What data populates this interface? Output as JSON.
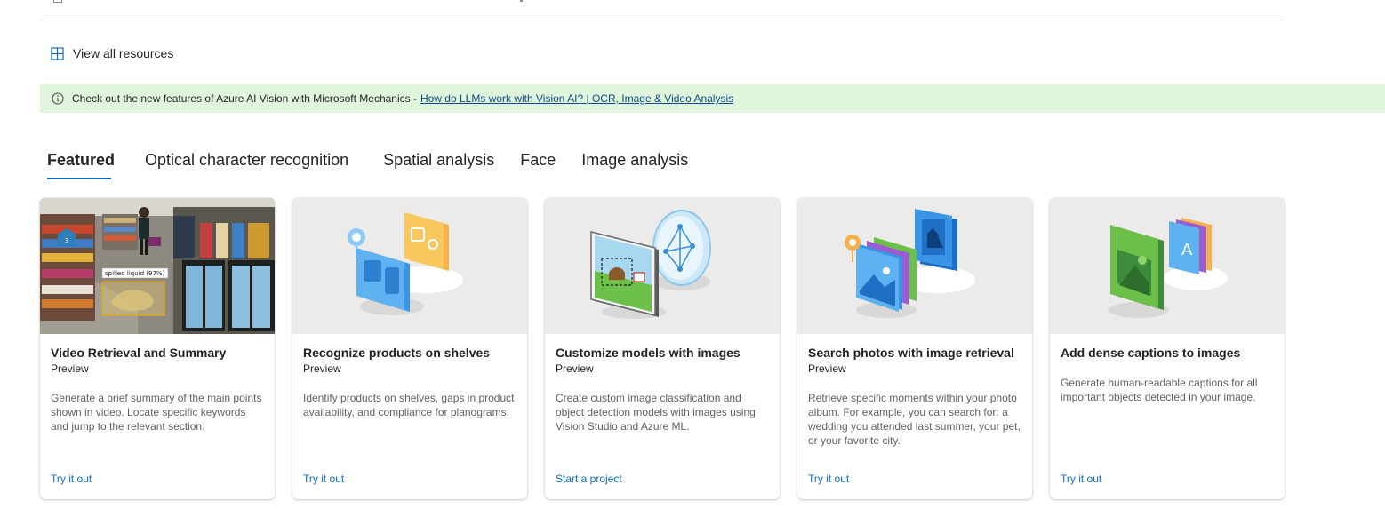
{
  "resources": {
    "view_all_label": "View all resources",
    "view_all_icon": "grid-icon"
  },
  "banner": {
    "icon": "info-icon",
    "text": "Check out the new features of Azure AI Vision with Microsoft Mechanics -",
    "link": "How do LLMs work with Vision AI? | OCR, Image & Video Analysis",
    "background": "#dff6dd"
  },
  "tabs": [
    {
      "label": "Featured",
      "active": true
    },
    {
      "label": "Optical character recognition",
      "active": false
    },
    {
      "label": "Spatial analysis",
      "active": false
    },
    {
      "label": "Face",
      "active": false
    },
    {
      "label": "Image analysis",
      "active": false
    }
  ],
  "cards": [
    {
      "title": "Video Retrieval and Summary",
      "subtitle": "Preview",
      "description": "Generate a brief summary of the main points shown in video. Locate specific keywords and jump to the relevant section.",
      "link": "Try it out",
      "image_label": "spilled liquid (97%)",
      "aisle_sign": "3"
    },
    {
      "title": "Recognize products on shelves",
      "subtitle": "Preview",
      "description": "Identify products on shelves, gaps in product availability, and compliance for planograms.",
      "link": "Try it out"
    },
    {
      "title": "Customize models with images",
      "subtitle": "Preview",
      "description": "Create custom image classification and object detection models with images using Vision Studio and Azure ML.",
      "link": "Start a project"
    },
    {
      "title": "Search photos with image retrieval",
      "subtitle": "Preview",
      "description": "Retrieve specific moments within your photo album. For example, you can search for: a wedding you attended last summer, your pet, or your favorite city.",
      "link": "Try it out"
    },
    {
      "title": "Add dense captions to images",
      "subtitle": "",
      "description": "Generate human-readable captions for all important objects detected in your image.",
      "link": "Try it out",
      "image_glyph": "A"
    }
  ],
  "colors": {
    "accent": "#0f6cbd",
    "link_banner": "#0f4a8a",
    "card_image_bg": "#ecebea"
  }
}
